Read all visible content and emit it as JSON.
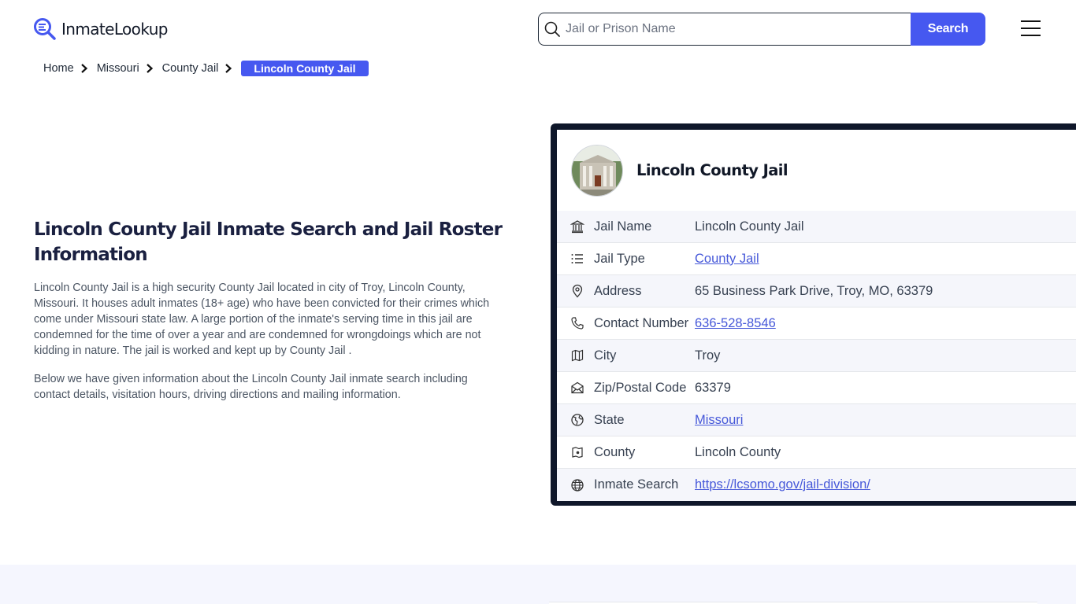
{
  "header": {
    "logo_text": "InmateLookup",
    "search": {
      "placeholder": "Jail or Prison Name",
      "value": "",
      "button_label": "Search"
    },
    "menu_icon": "hamburger-icon"
  },
  "breadcrumb": {
    "items": [
      "Home",
      "Missouri",
      "County Jail"
    ],
    "current": "Lincoln County Jail"
  },
  "intro": {
    "title": "Lincoln County Jail Inmate Search and Jail Roster Information",
    "paragraphs": [
      "Lincoln County Jail is a high security County Jail located in city of Troy, Lincoln County, Missouri. It houses adult inmates (18+ age) who have been convicted for their crimes which come under Missouri state law. A large portion of the inmate's serving time in this jail are condemned for the time of over a year and are condemned for wrongdoings which are not kidding in nature. The jail is worked and kept up by County Jail .",
      "Below we have given information about the Lincoln County Jail inmate search including contact details, visitation hours, driving directions and mailing information."
    ]
  },
  "card": {
    "title": "Lincoln County Jail",
    "rows": [
      {
        "icon": "bank-icon",
        "label": "Jail Name",
        "value": "Lincoln County Jail",
        "link": false
      },
      {
        "icon": "list-icon",
        "label": "Jail Type",
        "value": "County Jail",
        "link": true
      },
      {
        "icon": "map-pin-icon",
        "label": "Address",
        "value": "65 Business Park Drive, Troy, MO, 63379",
        "link": false
      },
      {
        "icon": "phone-icon",
        "label": "Contact Number",
        "value": "636-528-8546",
        "link": true
      },
      {
        "icon": "map-icon",
        "label": "City",
        "value": "Troy",
        "link": false
      },
      {
        "icon": "mail-open-icon",
        "label": "Zip/Postal Code",
        "value": "63379",
        "link": false
      },
      {
        "icon": "globe-alt-icon",
        "label": "State",
        "value": "Missouri",
        "link": true
      },
      {
        "icon": "county-map-icon",
        "label": "County",
        "value": "Lincoln County",
        "link": false
      },
      {
        "icon": "globe-icon",
        "label": "Inmate Search",
        "value": "https://lcsomo.gov/jail-division/",
        "link": true
      }
    ]
  },
  "colors": {
    "accent": "#4658f0",
    "card_border": "#0f172a",
    "link": "#4658d9",
    "band": "#f5f6fe"
  }
}
